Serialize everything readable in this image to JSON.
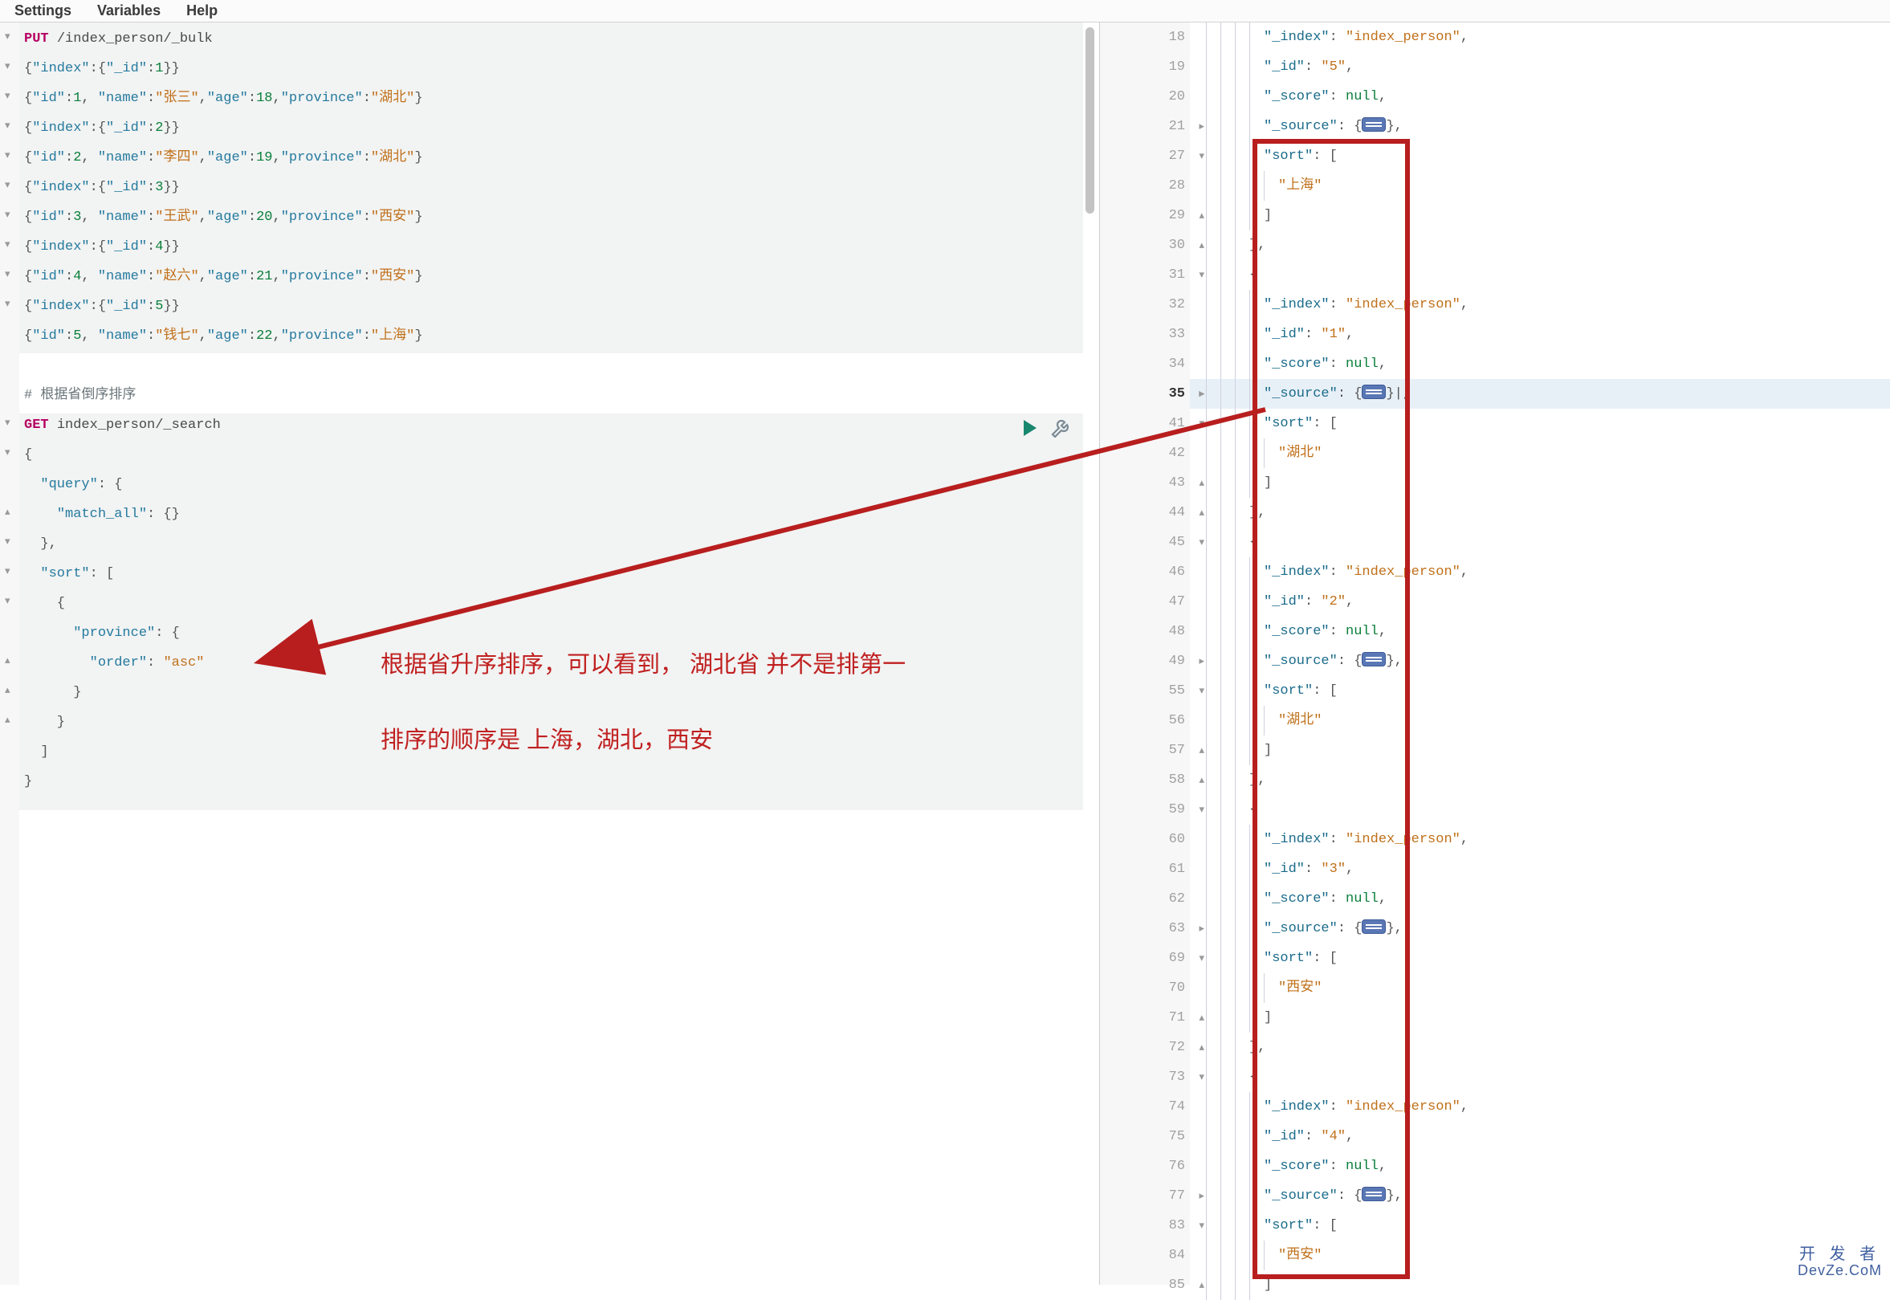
{
  "menu": {
    "settings": "Settings",
    "variables": "Variables",
    "help": "Help"
  },
  "left_group1_tokens": [
    [
      [
        "kw",
        "PUT"
      ],
      [
        "pun",
        " "
      ],
      [
        "path",
        "/index_person/_bulk"
      ]
    ],
    [
      [
        "pun",
        "{"
      ],
      [
        "prop",
        "\"index\""
      ],
      [
        "pun",
        ":{"
      ],
      [
        "prop",
        "\"_id\""
      ],
      [
        "pun",
        ":"
      ],
      [
        "num",
        "1"
      ],
      [
        "pun",
        "}}"
      ]
    ],
    [
      [
        "pun",
        "{"
      ],
      [
        "prop",
        "\"id\""
      ],
      [
        "pun",
        ":"
      ],
      [
        "num",
        "1"
      ],
      [
        "pun",
        ", "
      ],
      [
        "prop",
        "\"name\""
      ],
      [
        "pun",
        ":"
      ],
      [
        "str",
        "\"张三\""
      ],
      [
        "pun",
        ","
      ],
      [
        "prop",
        "\"age\""
      ],
      [
        "pun",
        ":"
      ],
      [
        "num",
        "18"
      ],
      [
        "pun",
        ","
      ],
      [
        "prop",
        "\"province\""
      ],
      [
        "pun",
        ":"
      ],
      [
        "str",
        "\"湖北\""
      ],
      [
        "pun",
        "}"
      ]
    ],
    [
      [
        "pun",
        "{"
      ],
      [
        "prop",
        "\"index\""
      ],
      [
        "pun",
        ":{"
      ],
      [
        "prop",
        "\"_id\""
      ],
      [
        "pun",
        ":"
      ],
      [
        "num",
        "2"
      ],
      [
        "pun",
        "}}"
      ]
    ],
    [
      [
        "pun",
        "{"
      ],
      [
        "prop",
        "\"id\""
      ],
      [
        "pun",
        ":"
      ],
      [
        "num",
        "2"
      ],
      [
        "pun",
        ", "
      ],
      [
        "prop",
        "\"name\""
      ],
      [
        "pun",
        ":"
      ],
      [
        "str",
        "\"李四\""
      ],
      [
        "pun",
        ","
      ],
      [
        "prop",
        "\"age\""
      ],
      [
        "pun",
        ":"
      ],
      [
        "num",
        "19"
      ],
      [
        "pun",
        ","
      ],
      [
        "prop",
        "\"province\""
      ],
      [
        "pun",
        ":"
      ],
      [
        "str",
        "\"湖北\""
      ],
      [
        "pun",
        "}"
      ]
    ],
    [
      [
        "pun",
        "{"
      ],
      [
        "prop",
        "\"index\""
      ],
      [
        "pun",
        ":{"
      ],
      [
        "prop",
        "\"_id\""
      ],
      [
        "pun",
        ":"
      ],
      [
        "num",
        "3"
      ],
      [
        "pun",
        "}}"
      ]
    ],
    [
      [
        "pun",
        "{"
      ],
      [
        "prop",
        "\"id\""
      ],
      [
        "pun",
        ":"
      ],
      [
        "num",
        "3"
      ],
      [
        "pun",
        ", "
      ],
      [
        "prop",
        "\"name\""
      ],
      [
        "pun",
        ":"
      ],
      [
        "str",
        "\"王武\""
      ],
      [
        "pun",
        ","
      ],
      [
        "prop",
        "\"age\""
      ],
      [
        "pun",
        ":"
      ],
      [
        "num",
        "20"
      ],
      [
        "pun",
        ","
      ],
      [
        "prop",
        "\"province\""
      ],
      [
        "pun",
        ":"
      ],
      [
        "str",
        "\"西安\""
      ],
      [
        "pun",
        "}"
      ]
    ],
    [
      [
        "pun",
        "{"
      ],
      [
        "prop",
        "\"index\""
      ],
      [
        "pun",
        ":{"
      ],
      [
        "prop",
        "\"_id\""
      ],
      [
        "pun",
        ":"
      ],
      [
        "num",
        "4"
      ],
      [
        "pun",
        "}}"
      ]
    ],
    [
      [
        "pun",
        "{"
      ],
      [
        "prop",
        "\"id\""
      ],
      [
        "pun",
        ":"
      ],
      [
        "num",
        "4"
      ],
      [
        "pun",
        ", "
      ],
      [
        "prop",
        "\"name\""
      ],
      [
        "pun",
        ":"
      ],
      [
        "str",
        "\"赵六\""
      ],
      [
        "pun",
        ","
      ],
      [
        "prop",
        "\"age\""
      ],
      [
        "pun",
        ":"
      ],
      [
        "num",
        "21"
      ],
      [
        "pun",
        ","
      ],
      [
        "prop",
        "\"province\""
      ],
      [
        "pun",
        ":"
      ],
      [
        "str",
        "\"西安\""
      ],
      [
        "pun",
        "}"
      ]
    ],
    [
      [
        "pun",
        "{"
      ],
      [
        "prop",
        "\"index\""
      ],
      [
        "pun",
        ":{"
      ],
      [
        "prop",
        "\"_id\""
      ],
      [
        "pun",
        ":"
      ],
      [
        "num",
        "5"
      ],
      [
        "pun",
        "}}"
      ]
    ],
    [
      [
        "pun",
        "{"
      ],
      [
        "prop",
        "\"id\""
      ],
      [
        "pun",
        ":"
      ],
      [
        "num",
        "5"
      ],
      [
        "pun",
        ", "
      ],
      [
        "prop",
        "\"name\""
      ],
      [
        "pun",
        ":"
      ],
      [
        "str",
        "\"钱七\""
      ],
      [
        "pun",
        ","
      ],
      [
        "prop",
        "\"age\""
      ],
      [
        "pun",
        ":"
      ],
      [
        "num",
        "22"
      ],
      [
        "pun",
        ","
      ],
      [
        "prop",
        "\"province\""
      ],
      [
        "pun",
        ":"
      ],
      [
        "str",
        "\"上海\""
      ],
      [
        "pun",
        "}"
      ]
    ]
  ],
  "left_comment": "# 根据省倒序排序",
  "left_group2_tokens": [
    [
      [
        "kw",
        "GET"
      ],
      [
        "pun",
        " "
      ],
      [
        "path",
        "index_person/_search"
      ]
    ],
    [
      [
        "pun",
        "{"
      ]
    ],
    [
      [
        "pun",
        "  "
      ],
      [
        "prop",
        "\"query\""
      ],
      [
        "pun",
        ": {"
      ]
    ],
    [
      [
        "pun",
        "    "
      ],
      [
        "prop",
        "\"match_all\""
      ],
      [
        "pun",
        ": {}"
      ]
    ],
    [
      [
        "pun",
        "  },"
      ]
    ],
    [
      [
        "pun",
        "  "
      ],
      [
        "prop",
        "\"sort\""
      ],
      [
        "pun",
        ": ["
      ]
    ],
    [
      [
        "pun",
        "    {"
      ]
    ],
    [
      [
        "pun",
        "      "
      ],
      [
        "prop",
        "\"province\""
      ],
      [
        "pun",
        ": {"
      ]
    ],
    [
      [
        "pun",
        "        "
      ],
      [
        "prop",
        "\"order\""
      ],
      [
        "pun",
        ": "
      ],
      [
        "str",
        "\"asc\""
      ]
    ],
    [
      [
        "pun",
        "      }"
      ]
    ],
    [
      [
        "pun",
        "    }"
      ]
    ],
    [
      [
        "pun",
        "  ]"
      ]
    ],
    [
      [
        "pun",
        "}"
      ]
    ]
  ],
  "left_fold_marks": [
    [
      1,
      "▾"
    ],
    [
      2,
      "▾"
    ],
    [
      3,
      "▾"
    ],
    [
      4,
      "▾"
    ],
    [
      5,
      "▾"
    ],
    [
      6,
      "▾"
    ],
    [
      7,
      "▾"
    ],
    [
      8,
      "▾"
    ],
    [
      9,
      "▾"
    ],
    [
      10,
      "▾"
    ],
    [
      14,
      "▾"
    ],
    [
      15,
      "▾"
    ],
    [
      17,
      "▴"
    ],
    [
      18,
      "▾"
    ],
    [
      19,
      "▾"
    ],
    [
      20,
      "▾"
    ],
    [
      22,
      "▴"
    ],
    [
      23,
      "▴"
    ],
    [
      24,
      "▴"
    ]
  ],
  "annotation": {
    "line1": "根据省升序排序，可以看到，  湖北省  并不是排第一",
    "line2": "排序的顺序是    上海，湖北，西安"
  },
  "right_lines": [
    {
      "n": "18",
      "indent": 4,
      "tok": [
        [
          "prop2",
          "\"_index\""
        ],
        [
          "pun",
          ": "
        ],
        [
          "str",
          "\"index_person\""
        ],
        [
          "pun",
          ","
        ]
      ]
    },
    {
      "n": "19",
      "indent": 4,
      "tok": [
        [
          "prop2",
          "\"_id\""
        ],
        [
          "pun",
          ": "
        ],
        [
          "str",
          "\"5\""
        ],
        [
          "pun",
          ","
        ]
      ]
    },
    {
      "n": "20",
      "indent": 4,
      "tok": [
        [
          "prop2",
          "\"_score\""
        ],
        [
          "pun",
          ": "
        ],
        [
          "null",
          "null"
        ],
        [
          "pun",
          ","
        ]
      ]
    },
    {
      "n": "21",
      "indent": 4,
      "fold": "▸",
      "tok": [
        [
          "prop2",
          "\"_source\""
        ],
        [
          "pun",
          ": {"
        ],
        [
          "badge",
          ""
        ],
        [
          "pun",
          "},"
        ]
      ]
    },
    {
      "n": "27",
      "indent": 4,
      "fold": "▾",
      "tok": [
        [
          "prop2",
          "\"sort\""
        ],
        [
          "pun",
          ": ["
        ]
      ]
    },
    {
      "n": "28",
      "indent": 5,
      "tok": [
        [
          "str",
          "\"上海\""
        ]
      ]
    },
    {
      "n": "29",
      "indent": 4,
      "fold": "▴",
      "tok": [
        [
          "pun",
          "]"
        ]
      ]
    },
    {
      "n": "30",
      "indent": 3,
      "fold": "▴",
      "tok": [
        [
          "pun",
          "},"
        ]
      ]
    },
    {
      "n": "31",
      "indent": 3,
      "fold": "▾",
      "tok": [
        [
          "pun",
          "{"
        ]
      ]
    },
    {
      "n": "32",
      "indent": 4,
      "tok": [
        [
          "prop2",
          "\"_index\""
        ],
        [
          "pun",
          ": "
        ],
        [
          "str",
          "\"index_person\""
        ],
        [
          "pun",
          ","
        ]
      ]
    },
    {
      "n": "33",
      "indent": 4,
      "tok": [
        [
          "prop2",
          "\"_id\""
        ],
        [
          "pun",
          ": "
        ],
        [
          "str",
          "\"1\""
        ],
        [
          "pun",
          ","
        ]
      ]
    },
    {
      "n": "34",
      "indent": 4,
      "tok": [
        [
          "prop2",
          "\"_score\""
        ],
        [
          "pun",
          ": "
        ],
        [
          "null",
          "null"
        ],
        [
          "pun",
          ","
        ]
      ]
    },
    {
      "n": "35",
      "indent": 4,
      "fold": "▸",
      "current": true,
      "tok": [
        [
          "prop2",
          "\"_source\""
        ],
        [
          "pun",
          ": {"
        ],
        [
          "badge",
          ""
        ],
        [
          "pun",
          "}"
        ],
        [
          "pun",
          "|,"
        ]
      ]
    },
    {
      "n": "41",
      "indent": 4,
      "fold": "▾",
      "tok": [
        [
          "prop2",
          "\"sort\""
        ],
        [
          "pun",
          ": ["
        ]
      ]
    },
    {
      "n": "42",
      "indent": 5,
      "tok": [
        [
          "str",
          "\"湖北\""
        ]
      ]
    },
    {
      "n": "43",
      "indent": 4,
      "fold": "▴",
      "tok": [
        [
          "pun",
          "]"
        ]
      ]
    },
    {
      "n": "44",
      "indent": 3,
      "fold": "▴",
      "tok": [
        [
          "pun",
          "},"
        ]
      ]
    },
    {
      "n": "45",
      "indent": 3,
      "fold": "▾",
      "tok": [
        [
          "pun",
          "{"
        ]
      ]
    },
    {
      "n": "46",
      "indent": 4,
      "tok": [
        [
          "prop2",
          "\"_index\""
        ],
        [
          "pun",
          ": "
        ],
        [
          "str",
          "\"index_person\""
        ],
        [
          "pun",
          ","
        ]
      ]
    },
    {
      "n": "47",
      "indent": 4,
      "tok": [
        [
          "prop2",
          "\"_id\""
        ],
        [
          "pun",
          ": "
        ],
        [
          "str",
          "\"2\""
        ],
        [
          "pun",
          ","
        ]
      ]
    },
    {
      "n": "48",
      "indent": 4,
      "tok": [
        [
          "prop2",
          "\"_score\""
        ],
        [
          "pun",
          ": "
        ],
        [
          "null",
          "null"
        ],
        [
          "pun",
          ","
        ]
      ]
    },
    {
      "n": "49",
      "indent": 4,
      "fold": "▸",
      "tok": [
        [
          "prop2",
          "\"_source\""
        ],
        [
          "pun",
          ": {"
        ],
        [
          "badge",
          ""
        ],
        [
          "pun",
          "},"
        ]
      ]
    },
    {
      "n": "55",
      "indent": 4,
      "fold": "▾",
      "tok": [
        [
          "prop2",
          "\"sort\""
        ],
        [
          "pun",
          ": ["
        ]
      ]
    },
    {
      "n": "56",
      "indent": 5,
      "tok": [
        [
          "str",
          "\"湖北\""
        ]
      ]
    },
    {
      "n": "57",
      "indent": 4,
      "fold": "▴",
      "tok": [
        [
          "pun",
          "]"
        ]
      ]
    },
    {
      "n": "58",
      "indent": 3,
      "fold": "▴",
      "tok": [
        [
          "pun",
          "},"
        ]
      ]
    },
    {
      "n": "59",
      "indent": 3,
      "fold": "▾",
      "tok": [
        [
          "pun",
          "{"
        ]
      ]
    },
    {
      "n": "60",
      "indent": 4,
      "tok": [
        [
          "prop2",
          "\"_index\""
        ],
        [
          "pun",
          ": "
        ],
        [
          "str",
          "\"index_person\""
        ],
        [
          "pun",
          ","
        ]
      ]
    },
    {
      "n": "61",
      "indent": 4,
      "tok": [
        [
          "prop2",
          "\"_id\""
        ],
        [
          "pun",
          ": "
        ],
        [
          "str",
          "\"3\""
        ],
        [
          "pun",
          ","
        ]
      ]
    },
    {
      "n": "62",
      "indent": 4,
      "tok": [
        [
          "prop2",
          "\"_score\""
        ],
        [
          "pun",
          ": "
        ],
        [
          "null",
          "null"
        ],
        [
          "pun",
          ","
        ]
      ]
    },
    {
      "n": "63",
      "indent": 4,
      "fold": "▸",
      "tok": [
        [
          "prop2",
          "\"_source\""
        ],
        [
          "pun",
          ": {"
        ],
        [
          "badge",
          ""
        ],
        [
          "pun",
          "},"
        ]
      ]
    },
    {
      "n": "69",
      "indent": 4,
      "fold": "▾",
      "tok": [
        [
          "prop2",
          "\"sort\""
        ],
        [
          "pun",
          ": ["
        ]
      ]
    },
    {
      "n": "70",
      "indent": 5,
      "tok": [
        [
          "str",
          "\"西安\""
        ]
      ]
    },
    {
      "n": "71",
      "indent": 4,
      "fold": "▴",
      "tok": [
        [
          "pun",
          "]"
        ]
      ]
    },
    {
      "n": "72",
      "indent": 3,
      "fold": "▴",
      "tok": [
        [
          "pun",
          "},"
        ]
      ]
    },
    {
      "n": "73",
      "indent": 3,
      "fold": "▾",
      "tok": [
        [
          "pun",
          "{"
        ]
      ]
    },
    {
      "n": "74",
      "indent": 4,
      "tok": [
        [
          "prop2",
          "\"_index\""
        ],
        [
          "pun",
          ": "
        ],
        [
          "str",
          "\"index_person\""
        ],
        [
          "pun",
          ","
        ]
      ]
    },
    {
      "n": "75",
      "indent": 4,
      "tok": [
        [
          "prop2",
          "\"_id\""
        ],
        [
          "pun",
          ": "
        ],
        [
          "str",
          "\"4\""
        ],
        [
          "pun",
          ","
        ]
      ]
    },
    {
      "n": "76",
      "indent": 4,
      "tok": [
        [
          "prop2",
          "\"_score\""
        ],
        [
          "pun",
          ": "
        ],
        [
          "null",
          "null"
        ],
        [
          "pun",
          ","
        ]
      ]
    },
    {
      "n": "77",
      "indent": 4,
      "fold": "▸",
      "tok": [
        [
          "prop2",
          "\"_source\""
        ],
        [
          "pun",
          ": {"
        ],
        [
          "badge",
          ""
        ],
        [
          "pun",
          "},"
        ]
      ]
    },
    {
      "n": "83",
      "indent": 4,
      "fold": "▾",
      "tok": [
        [
          "prop2",
          "\"sort\""
        ],
        [
          "pun",
          ": ["
        ]
      ]
    },
    {
      "n": "84",
      "indent": 5,
      "tok": [
        [
          "str",
          "\"西安\""
        ]
      ]
    },
    {
      "n": "85",
      "indent": 4,
      "fold": "▴",
      "tok": [
        [
          "pun",
          "]"
        ]
      ]
    }
  ],
  "watermark": {
    "top": "开 发 者",
    "bottom": "DevZe.CoM"
  },
  "colors": {
    "red": "#b81e1e",
    "accent": "#18876e"
  }
}
